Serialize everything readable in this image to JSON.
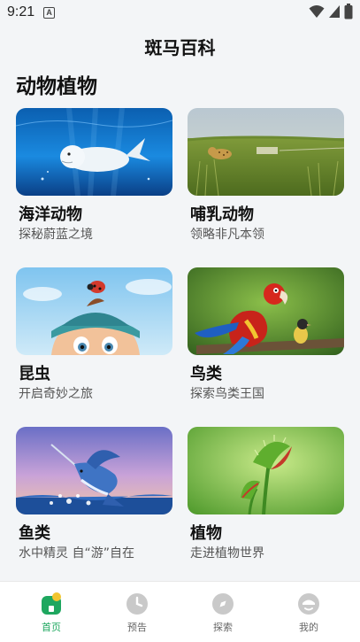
{
  "status": {
    "time": "9:21",
    "notification_badge": "A"
  },
  "header": {
    "title": "斑马百科"
  },
  "section": {
    "title": "动物植物"
  },
  "categories": [
    {
      "name": "海洋动物",
      "desc": "探秘蔚蓝之境",
      "image": "whale-underwater"
    },
    {
      "name": "哺乳动物",
      "desc": "领略非凡本领",
      "image": "leopard-grassland"
    },
    {
      "name": "昆虫",
      "desc": "开启奇妙之旅",
      "image": "cartoon-kid-with-ladybug"
    },
    {
      "name": "鸟类",
      "desc": "探索鸟类王国",
      "image": "parrot-and-small-bird"
    },
    {
      "name": "鱼类",
      "desc": "水中精灵 自“游”自在",
      "image": "marlin-jumping"
    },
    {
      "name": "植物",
      "desc": "走进植物世界",
      "image": "venus-flytrap"
    }
  ],
  "tabs": [
    {
      "label": "首页",
      "icon": "home-icon",
      "active": true
    },
    {
      "label": "预告",
      "icon": "clock-icon",
      "active": false
    },
    {
      "label": "探索",
      "icon": "compass-icon",
      "active": false
    },
    {
      "label": "我的",
      "icon": "profile-icon",
      "active": false
    }
  ],
  "colors": {
    "accent": "#1ea75f",
    "background": "#f3f5f7"
  }
}
